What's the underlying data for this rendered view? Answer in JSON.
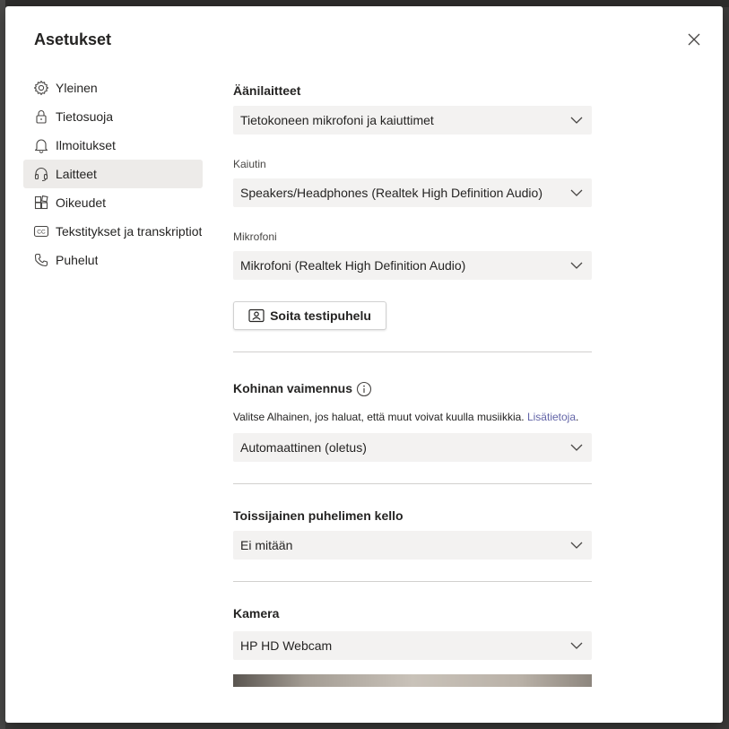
{
  "dialog": {
    "title": "Asetukset",
    "close_icon": "close-icon"
  },
  "nav": {
    "items": [
      {
        "label": "Yleinen",
        "icon": "gear-icon"
      },
      {
        "label": "Tietosuoja",
        "icon": "lock-icon"
      },
      {
        "label": "Ilmoitukset",
        "icon": "bell-icon"
      },
      {
        "label": "Laitteet",
        "icon": "headset-icon",
        "active": true
      },
      {
        "label": "Oikeudet",
        "icon": "apps-icon"
      },
      {
        "label": "Tekstitykset ja transkriptiot",
        "icon": "closed-captions-icon"
      },
      {
        "label": "Puhelut",
        "icon": "phone-icon"
      }
    ]
  },
  "audio": {
    "heading": "Äänilaitteet",
    "device_value": "Tietokoneen mikrofoni ja kaiuttimet",
    "speaker_label": "Kaiutin",
    "speaker_value": "Speakers/Headphones (Realtek High Definition Audio)",
    "mic_label": "Mikrofoni",
    "mic_value": "Mikrofoni (Realtek High Definition Audio)",
    "test_call_label": "Soita testipuhelu"
  },
  "noise": {
    "heading": "Kohinan vaimennus",
    "hint": "Valitse Alhainen, jos haluat, että muut voivat kuulla musiikkia.",
    "link": "Lisätietoja",
    "link_suffix": ".",
    "value": "Automaattinen (oletus)"
  },
  "ringer": {
    "heading": "Toissijainen puhelimen kello",
    "value": "Ei mitään"
  },
  "camera": {
    "heading": "Kamera",
    "value": "HP HD Webcam"
  },
  "colors": {
    "accent": "#6264a7",
    "active_nav": "#edebe9",
    "select_bg": "#f3f2f1"
  }
}
